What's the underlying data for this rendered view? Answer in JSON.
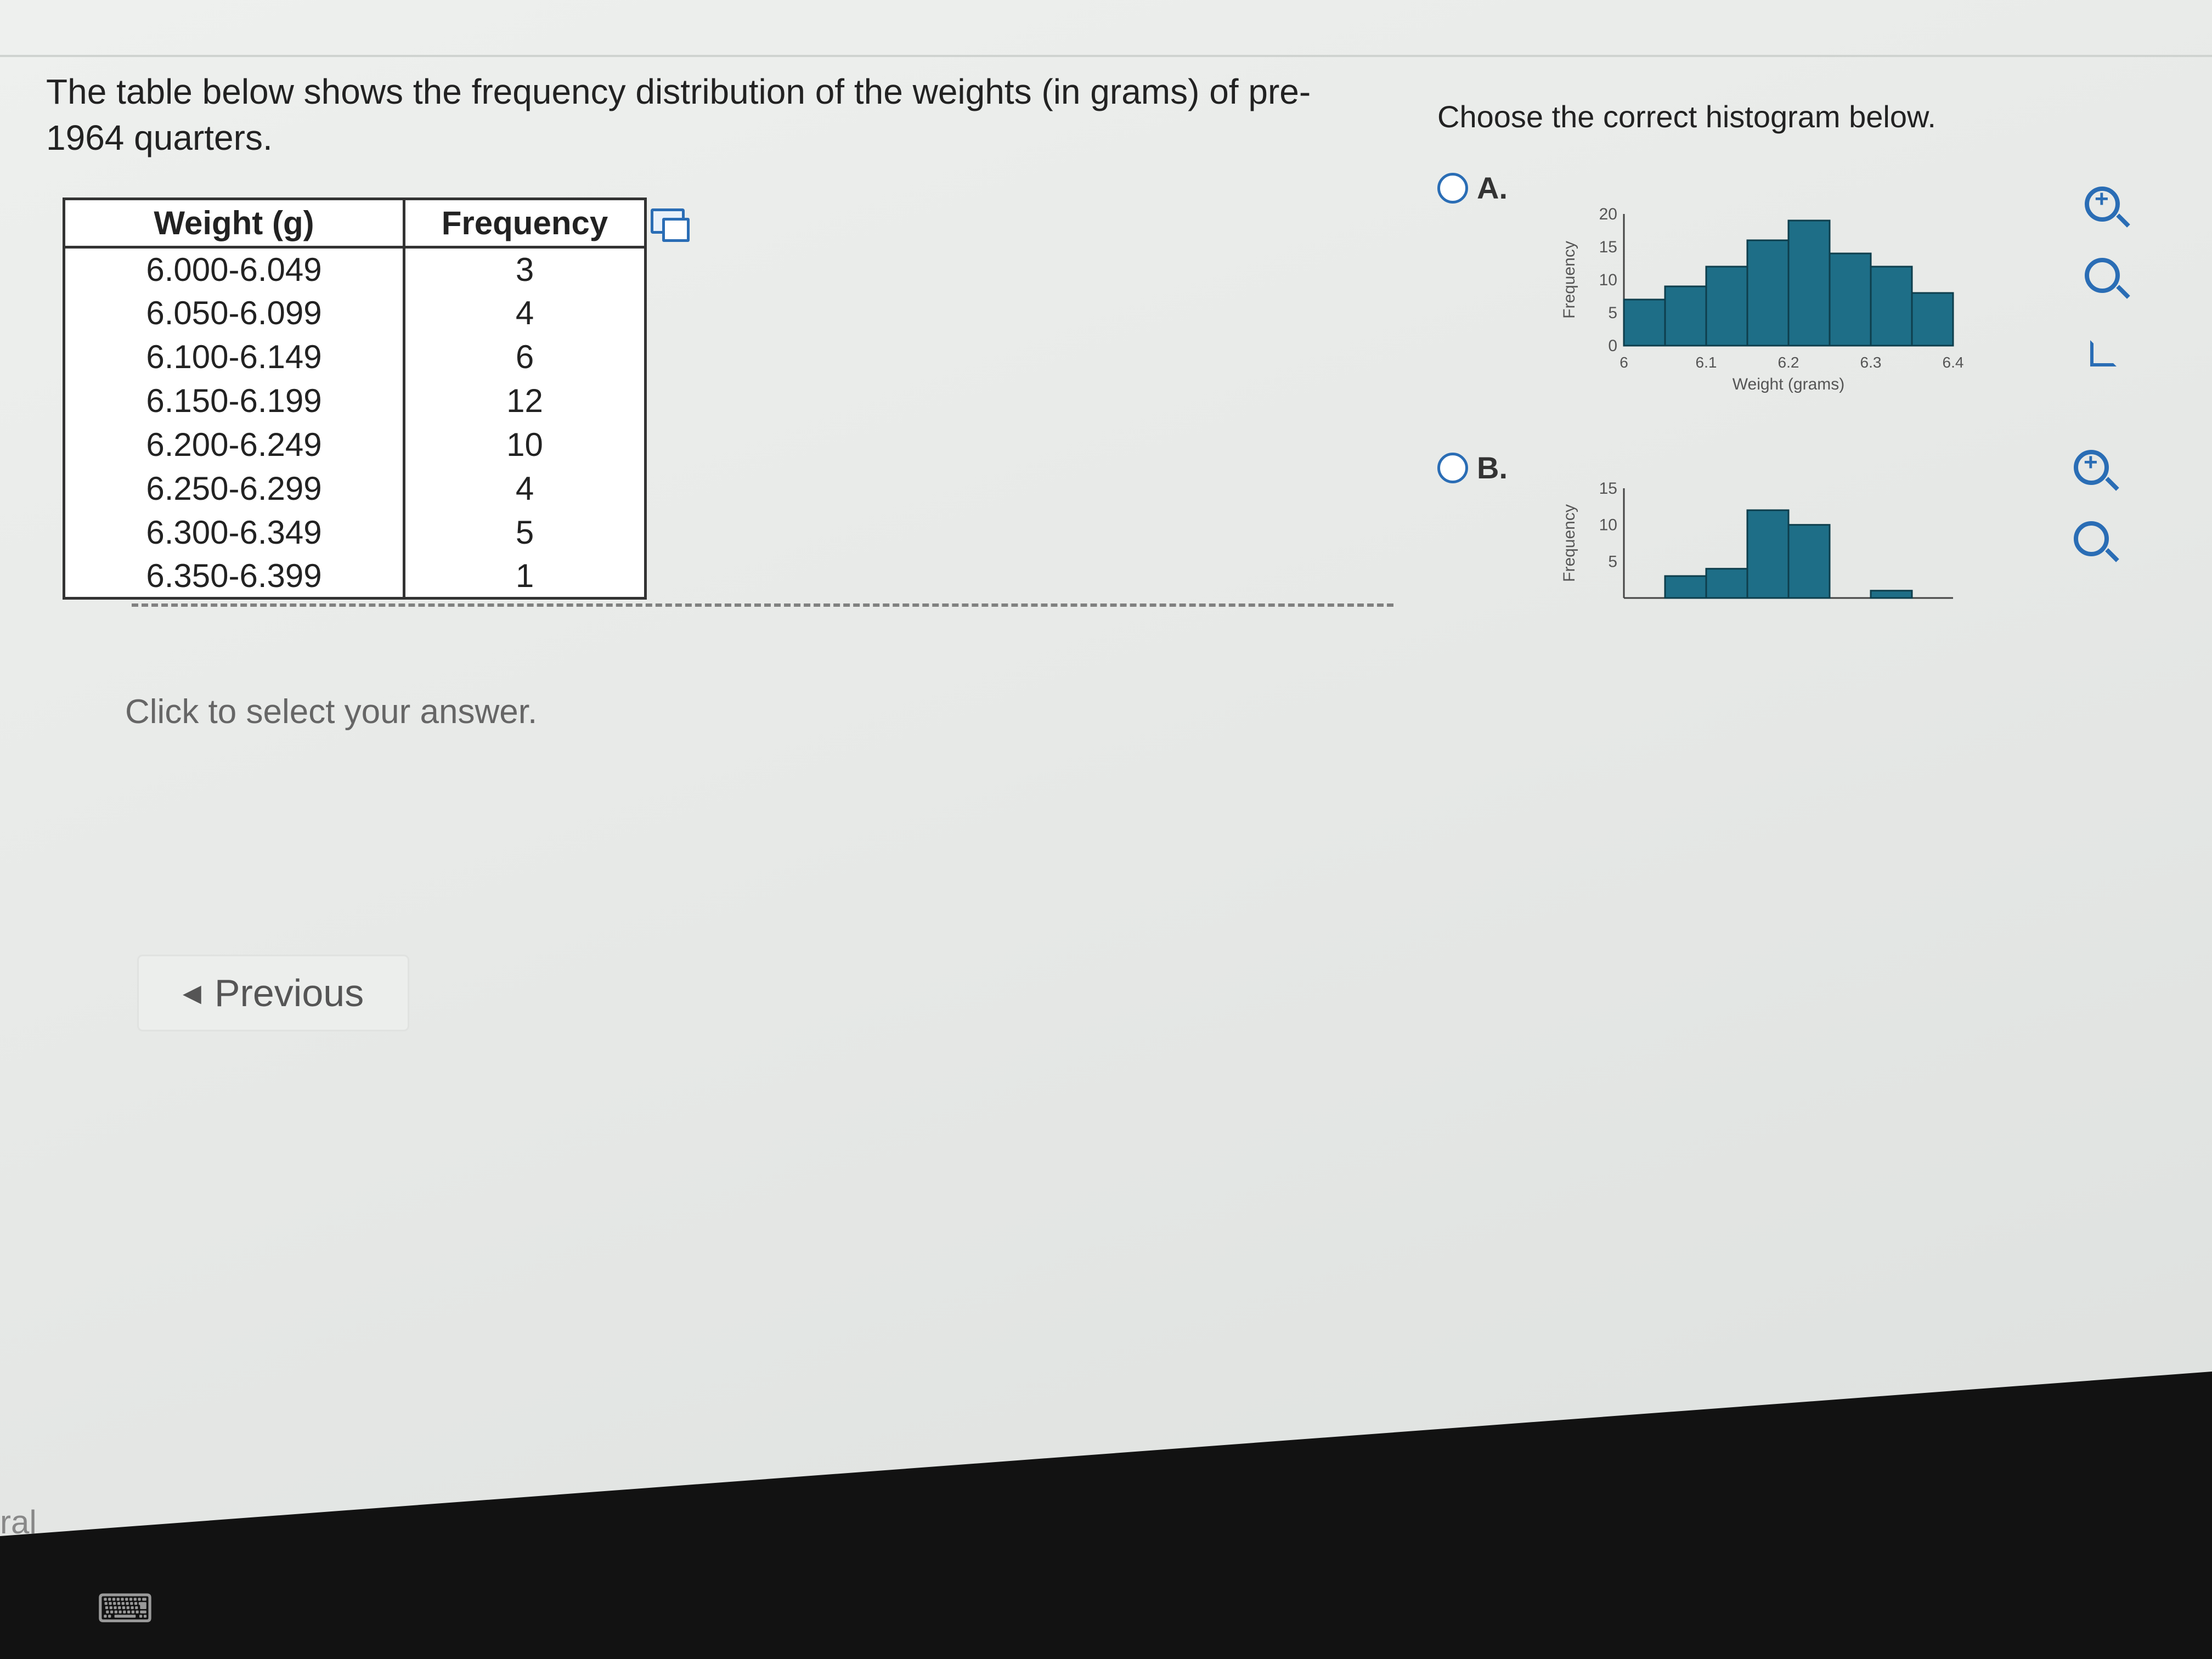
{
  "question": {
    "text": "The table below shows the frequency distribution of the weights (in grams) of pre-1964 quarters."
  },
  "table": {
    "headers": [
      "Weight (g)",
      "Frequency"
    ],
    "rows": [
      [
        "6.000-6.049",
        "3"
      ],
      [
        "6.050-6.099",
        "4"
      ],
      [
        "6.100-6.149",
        "6"
      ],
      [
        "6.150-6.199",
        "12"
      ],
      [
        "6.200-6.249",
        "10"
      ],
      [
        "6.250-6.299",
        "4"
      ],
      [
        "6.300-6.349",
        "5"
      ],
      [
        "6.350-6.399",
        "1"
      ]
    ]
  },
  "answer": {
    "prompt": "Click to select your answer."
  },
  "nav": {
    "previous_label": "Previous"
  },
  "right": {
    "instruction": "Choose the correct histogram below.",
    "option_a": "A.",
    "option_b": "B."
  },
  "chart_data": [
    {
      "type": "bar",
      "xlabel": "Weight (grams)",
      "ylabel": "Frequency",
      "x_ticks": [
        "6",
        "6.1",
        "6.2",
        "6.3",
        "6.4"
      ],
      "y_ticks": [
        "0",
        "5",
        "10",
        "15",
        "20"
      ],
      "ylim": [
        0,
        20
      ],
      "bins": [
        [
          6.0,
          6.05
        ],
        [
          6.05,
          6.1
        ],
        [
          6.1,
          6.15
        ],
        [
          6.15,
          6.2
        ],
        [
          6.2,
          6.25
        ],
        [
          6.25,
          6.3
        ],
        [
          6.3,
          6.35
        ],
        [
          6.35,
          6.4
        ]
      ],
      "values": [
        7,
        9,
        12,
        16,
        19,
        14,
        12,
        8
      ]
    },
    {
      "type": "bar",
      "xlabel": "",
      "ylabel": "Frequency",
      "y_ticks": [
        "5",
        "10",
        "15"
      ],
      "ylim": [
        0,
        15
      ],
      "bins": [
        [
          6.0,
          6.05
        ],
        [
          6.05,
          6.1
        ],
        [
          6.1,
          6.15
        ],
        [
          6.15,
          6.2
        ],
        [
          6.2,
          6.25
        ],
        [
          6.25,
          6.3
        ],
        [
          6.3,
          6.35
        ],
        [
          6.35,
          6.4
        ]
      ],
      "values": [
        0,
        3,
        4,
        12,
        10,
        0,
        1,
        0
      ]
    }
  ],
  "colors": {
    "bar": "#1e6e87",
    "accent": "#2a6db5"
  },
  "misc": {
    "left_fragment": "ral"
  }
}
